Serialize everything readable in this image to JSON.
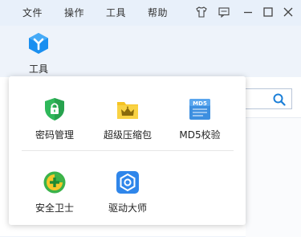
{
  "menu": {
    "items": [
      {
        "label": "文件"
      },
      {
        "label": "操作"
      },
      {
        "label": "工具"
      },
      {
        "label": "帮助"
      }
    ]
  },
  "window_controls": {
    "icons": [
      "shirt-icon",
      "feedback-icon",
      "minimize-icon",
      "maximize-icon",
      "close-icon"
    ]
  },
  "toolbar": {
    "tools_label": "工具",
    "tools_icon": "tools-cube-icon",
    "accent": "#1a8ff0"
  },
  "tools_popup": {
    "rows": [
      {
        "items": [
          {
            "label": "密码管理",
            "icon": "password-shield-icon",
            "color": "#2fb85a"
          },
          {
            "label": "超级压缩包",
            "icon": "zip-folder-icon",
            "color": "#f5c323"
          },
          {
            "label": "MD5校验",
            "icon": "md5-check-icon",
            "color": "#3d8fe0"
          }
        ]
      },
      {
        "items": [
          {
            "label": "安全卫士",
            "icon": "security-guard-icon",
            "color": "#3bb34a"
          },
          {
            "label": "驱动大师",
            "icon": "driver-master-icon",
            "color": "#2f86ea"
          }
        ]
      }
    ]
  },
  "search": {
    "icon": "search-icon",
    "icon_color": "#1b7fd8"
  }
}
